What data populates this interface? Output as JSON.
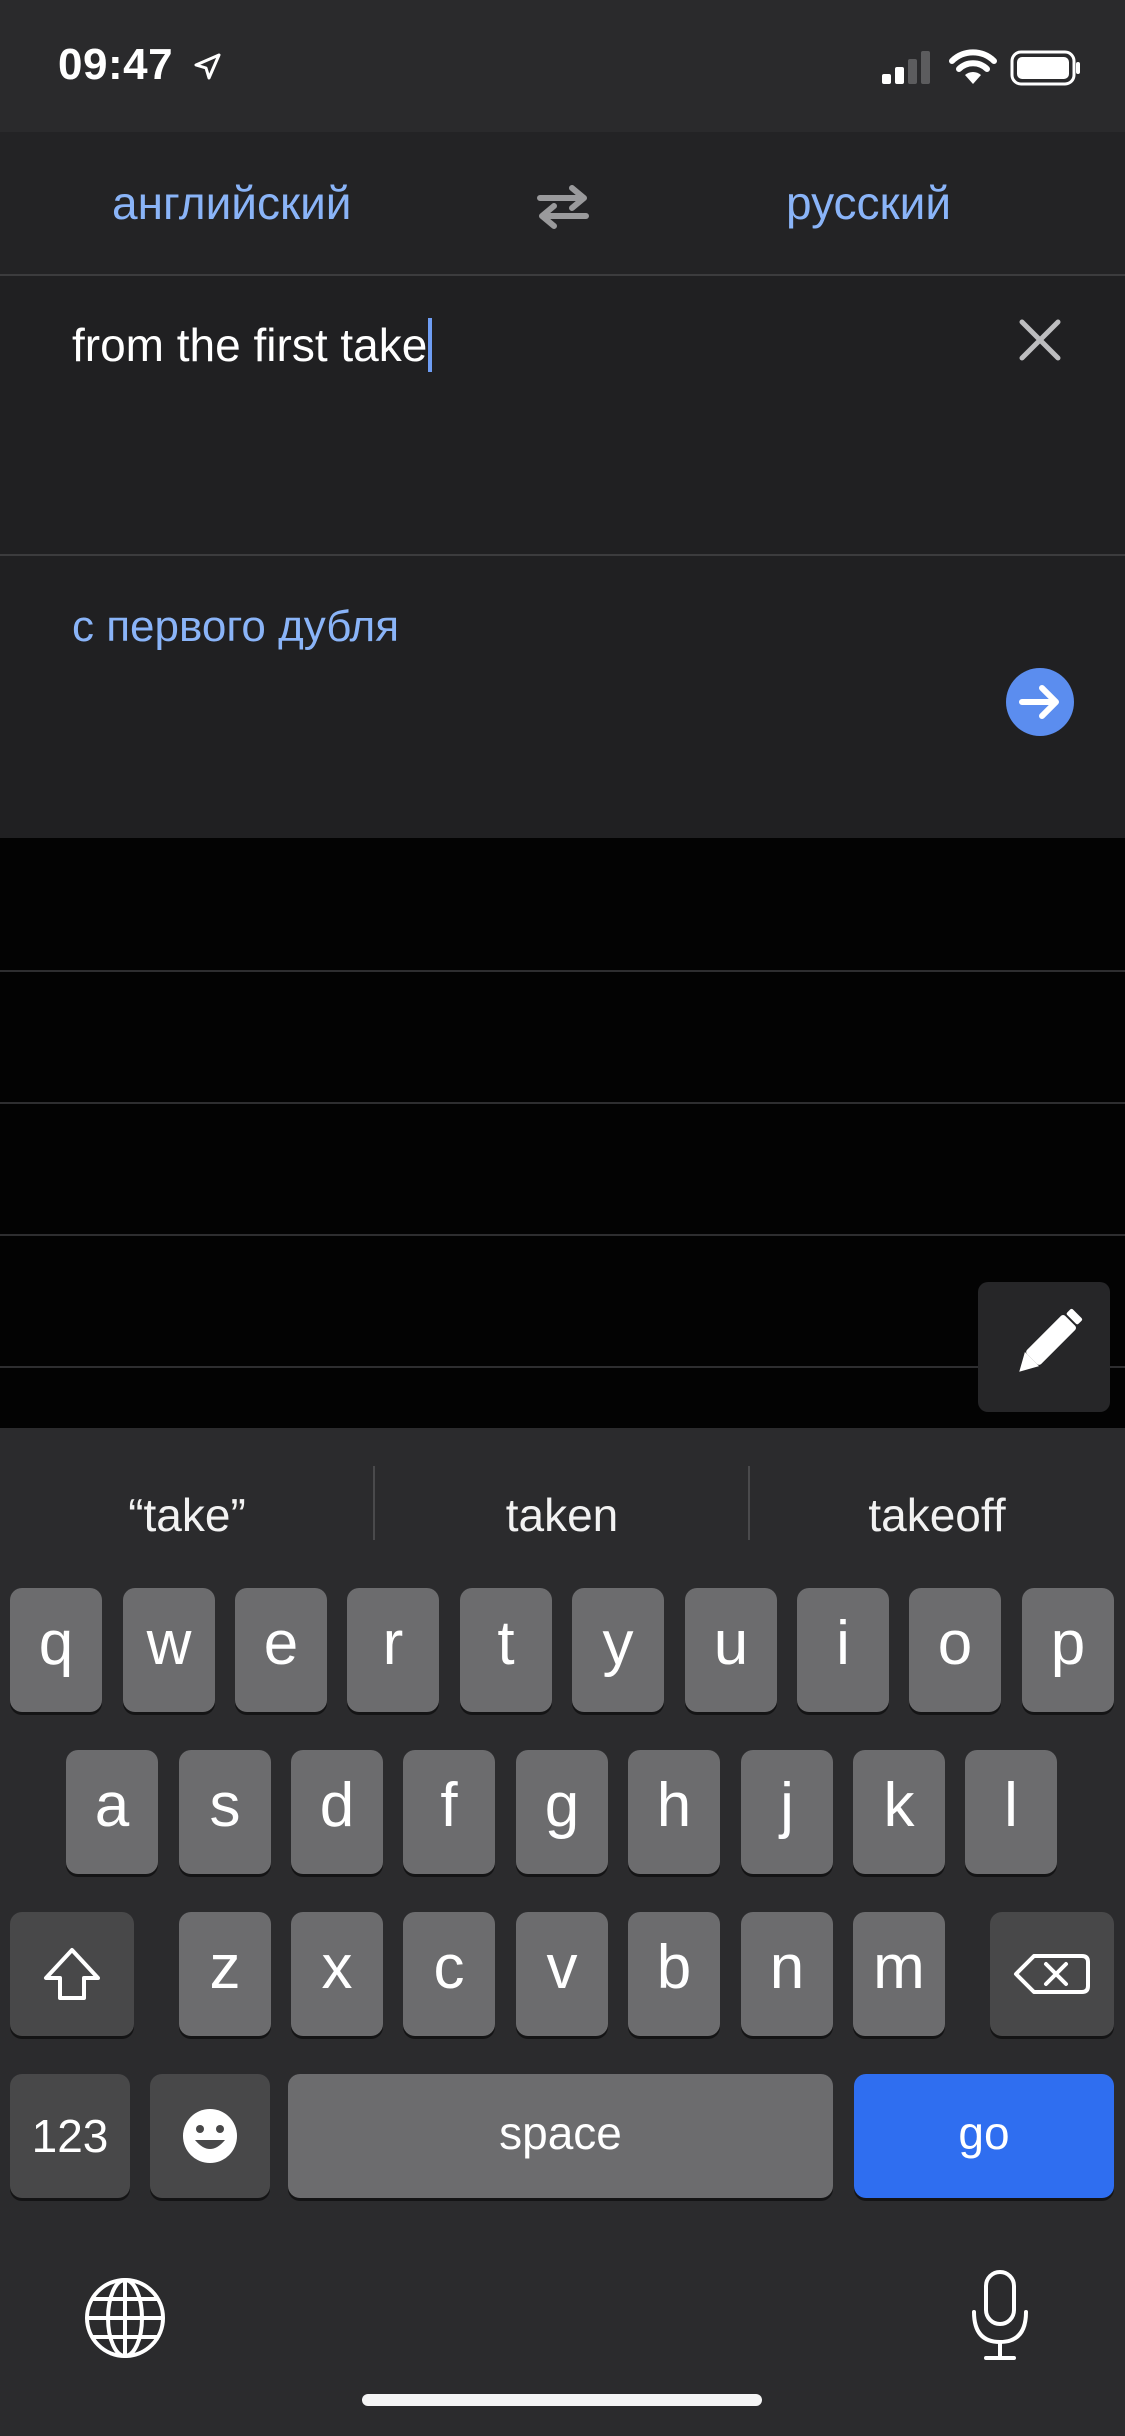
{
  "status_bar": {
    "time": "09:47",
    "icons": [
      "location-arrow-icon",
      "signal-icon",
      "wifi-icon",
      "battery-icon"
    ]
  },
  "languages": {
    "source": "английский",
    "target": "русский",
    "swap_icon": "swap-arrows-icon"
  },
  "input": {
    "value": "from the first take",
    "clear_icon": "close-icon"
  },
  "translation": {
    "text": "с первого дубля",
    "action_icon": "arrow-right-icon"
  },
  "handwrite": {
    "icon": "pen-icon"
  },
  "keyboard": {
    "suggestions": [
      "“take”",
      "taken",
      "takeoff"
    ],
    "row1": [
      "q",
      "w",
      "e",
      "r",
      "t",
      "y",
      "u",
      "i",
      "o",
      "p"
    ],
    "row2": [
      "a",
      "s",
      "d",
      "f",
      "g",
      "h",
      "j",
      "k",
      "l"
    ],
    "row3": [
      "z",
      "x",
      "c",
      "v",
      "b",
      "n",
      "m"
    ],
    "numbers_label": "123",
    "space_label": "space",
    "go_label": "go",
    "icons": [
      "shift-icon",
      "backspace-icon",
      "emoji-icon",
      "globe-icon",
      "microphone-icon"
    ]
  },
  "colors": {
    "accent": "#8ab4f8",
    "go_key": "#2f6ef0",
    "background": "#030303"
  }
}
